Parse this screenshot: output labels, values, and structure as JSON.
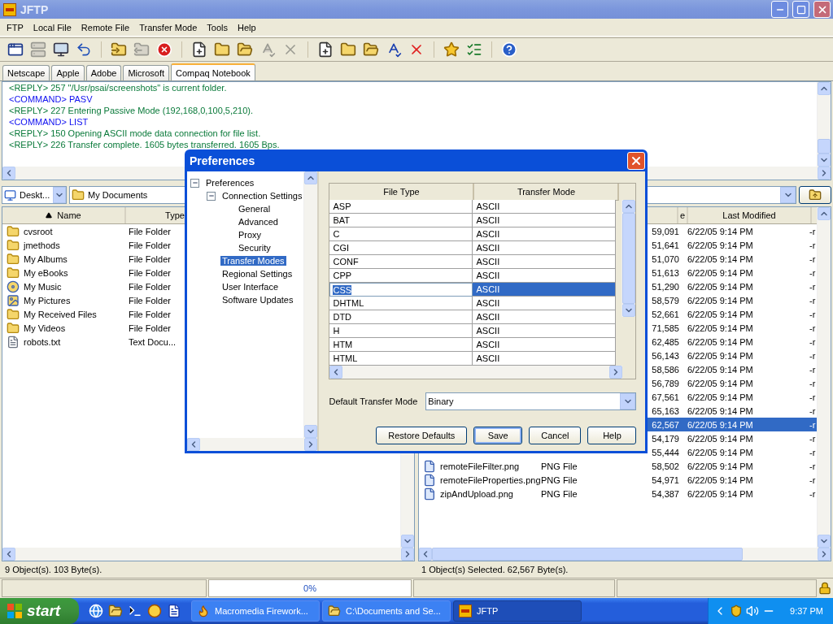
{
  "window": {
    "title": "JFTP"
  },
  "menu": [
    "FTP",
    "Local File",
    "Remote File",
    "Transfer Mode",
    "Tools",
    "Help"
  ],
  "toolbar": [
    {
      "kind": "window",
      "disabled": false
    },
    {
      "kind": "server",
      "disabled": true
    },
    {
      "kind": "monitor",
      "disabled": false
    },
    {
      "kind": "undo",
      "disabled": false
    },
    {
      "kind": "separator"
    },
    {
      "kind": "download",
      "disabled": false
    },
    {
      "kind": "upload",
      "disabled": true
    },
    {
      "kind": "stop",
      "disabled": false
    },
    {
      "kind": "separator"
    },
    {
      "kind": "new-file",
      "disabled": false
    },
    {
      "kind": "new-folder",
      "disabled": false
    },
    {
      "kind": "open-folder",
      "disabled": false
    },
    {
      "kind": "rename",
      "disabled": true
    },
    {
      "kind": "delete",
      "disabled": true
    },
    {
      "kind": "separator"
    },
    {
      "kind": "new-file",
      "disabled": false
    },
    {
      "kind": "new-folder",
      "disabled": false
    },
    {
      "kind": "open-folder",
      "disabled": false
    },
    {
      "kind": "rename",
      "disabled": false
    },
    {
      "kind": "delete",
      "disabled": false
    },
    {
      "kind": "separator"
    },
    {
      "kind": "favorite",
      "disabled": false
    },
    {
      "kind": "list",
      "disabled": false
    },
    {
      "kind": "separator"
    },
    {
      "kind": "help",
      "disabled": false
    }
  ],
  "tabs": [
    {
      "label": "Netscape",
      "selected": false
    },
    {
      "label": "Apple",
      "selected": false
    },
    {
      "label": "Adobe",
      "selected": false
    },
    {
      "label": "Microsoft",
      "selected": false
    },
    {
      "label": "Compaq Notebook",
      "selected": true
    }
  ],
  "log": [
    {
      "kind": "reply",
      "text": "<REPLY> 257 \"/Usr/psai/screenshots\" is current folder."
    },
    {
      "kind": "command",
      "text": "<COMMAND> PASV"
    },
    {
      "kind": "reply",
      "text": "<REPLY> 227 Entering Passive Mode (192,168,0,100,5,210)."
    },
    {
      "kind": "command",
      "text": "<COMMAND> LIST"
    },
    {
      "kind": "reply",
      "text": "<REPLY> 150 Opening ASCII mode data connection for file list."
    },
    {
      "kind": "reply",
      "text": "<REPLY> 226 Transfer complete. 1605 bytes transferred. 1605 Bps."
    }
  ],
  "local_pane": {
    "drive": "Deskt...",
    "path": "My Documents",
    "columns": [
      "Name",
      "Type"
    ],
    "rows": [
      {
        "kind": "folder",
        "name": "cvsroot",
        "type": "File Folder"
      },
      {
        "kind": "folder",
        "name": "jmethods",
        "type": "File Folder"
      },
      {
        "kind": "folder",
        "name": "My Albums",
        "type": "File Folder"
      },
      {
        "kind": "folder",
        "name": "My eBooks",
        "type": "File Folder"
      },
      {
        "kind": "music",
        "name": "My Music",
        "type": "File Folder"
      },
      {
        "kind": "pictures",
        "name": "My Pictures",
        "type": "File Folder"
      },
      {
        "kind": "folder",
        "name": "My Received Files",
        "type": "File Folder"
      },
      {
        "kind": "folder",
        "name": "My Videos",
        "type": "File Folder"
      },
      {
        "kind": "text",
        "name": "robots.txt",
        "type": "Text Docu..."
      }
    ],
    "status": "9 Object(s). 103 Byte(s)."
  },
  "remote_pane": {
    "headers": {
      "size": "e",
      "modified": "Last Modified"
    },
    "rows": [
      {
        "size": "59,091",
        "modified": "6/22/05 9:14 PM",
        "perm": "-r",
        "selected": false
      },
      {
        "size": "51,641",
        "modified": "6/22/05 9:14 PM",
        "perm": "-r",
        "selected": false
      },
      {
        "size": "51,070",
        "modified": "6/22/05 9:14 PM",
        "perm": "-r",
        "selected": false
      },
      {
        "size": "51,613",
        "modified": "6/22/05 9:14 PM",
        "perm": "-r",
        "selected": false
      },
      {
        "size": "51,290",
        "modified": "6/22/05 9:14 PM",
        "perm": "-r",
        "selected": false
      },
      {
        "size": "58,579",
        "modified": "6/22/05 9:14 PM",
        "perm": "-r",
        "selected": false
      },
      {
        "size": "52,661",
        "modified": "6/22/05 9:14 PM",
        "perm": "-r",
        "selected": false
      },
      {
        "size": "71,585",
        "modified": "6/22/05 9:14 PM",
        "perm": "-r",
        "selected": false
      },
      {
        "size": "62,485",
        "modified": "6/22/05 9:14 PM",
        "perm": "-r",
        "selected": false
      },
      {
        "size": "56,143",
        "modified": "6/22/05 9:14 PM",
        "perm": "-r",
        "selected": false
      },
      {
        "size": "58,586",
        "modified": "6/22/05 9:14 PM",
        "perm": "-r",
        "selected": false
      },
      {
        "size": "56,789",
        "modified": "6/22/05 9:14 PM",
        "perm": "-r",
        "selected": false
      },
      {
        "size": "67,561",
        "modified": "6/22/05 9:14 PM",
        "perm": "-r",
        "selected": false
      },
      {
        "size": "65,163",
        "modified": "6/22/05 9:14 PM",
        "perm": "-r",
        "selected": false
      },
      {
        "size": "62,567",
        "modified": "6/22/05 9:14 PM",
        "perm": "-r",
        "selected": true
      },
      {
        "size": "54,179",
        "modified": "6/22/05 9:14 PM",
        "perm": "-r",
        "selected": false
      },
      {
        "size": "55,444",
        "modified": "6/22/05 9:14 PM",
        "perm": "-r",
        "selected": false
      },
      {
        "kind": "image",
        "name": "remoteFileFilter.png",
        "type": "PNG File",
        "size": "58,502",
        "modified": "6/22/05 9:14 PM",
        "perm": "-r",
        "selected": false
      },
      {
        "kind": "image",
        "name": "remoteFileProperties.png",
        "type": "PNG File",
        "size": "54,971",
        "modified": "6/22/05 9:14 PM",
        "perm": "-r",
        "selected": false
      },
      {
        "kind": "image",
        "name": "zipAndUpload.png",
        "type": "PNG File",
        "size": "54,387",
        "modified": "6/22/05 9:14 PM",
        "perm": "-r",
        "selected": false
      }
    ],
    "status": "1 Object(s) Selected. 62,567 Byte(s)."
  },
  "progress": {
    "label": "0%",
    "level": 0
  },
  "dialog": {
    "title": "Preferences",
    "tree": [
      {
        "label": "Preferences",
        "expanded": true,
        "selected": false,
        "children": [
          {
            "label": "Connection Settings",
            "expanded": true,
            "selected": false,
            "children": [
              {
                "label": "General",
                "selected": false
              },
              {
                "label": "Advanced",
                "selected": false
              },
              {
                "label": "Proxy",
                "selected": false
              },
              {
                "label": "Security",
                "selected": false
              }
            ]
          },
          {
            "label": "Transfer Modes",
            "selected": true
          },
          {
            "label": "Regional Settings",
            "selected": false
          },
          {
            "label": "User Interface",
            "selected": false
          },
          {
            "label": "Software Updates",
            "selected": false
          }
        ]
      }
    ],
    "table": {
      "columns": [
        "File Type",
        "Transfer Mode"
      ],
      "rows": [
        {
          "file_type": "ASP",
          "mode": "ASCII",
          "selected": false
        },
        {
          "file_type": "BAT",
          "mode": "ASCII",
          "selected": false
        },
        {
          "file_type": "C",
          "mode": "ASCII",
          "selected": false
        },
        {
          "file_type": "CGI",
          "mode": "ASCII",
          "selected": false
        },
        {
          "file_type": "CONF",
          "mode": "ASCII",
          "selected": false
        },
        {
          "file_type": "CPP",
          "mode": "ASCII",
          "selected": false
        },
        {
          "file_type": "CSS",
          "mode": "ASCII",
          "selected": true
        },
        {
          "file_type": "DHTML",
          "mode": "ASCII",
          "selected": false
        },
        {
          "file_type": "DTD",
          "mode": "ASCII",
          "selected": false
        },
        {
          "file_type": "H",
          "mode": "ASCII",
          "selected": false
        },
        {
          "file_type": "HTM",
          "mode": "ASCII",
          "selected": false
        },
        {
          "file_type": "HTML",
          "mode": "ASCII",
          "selected": false
        }
      ]
    },
    "default_mode": {
      "label": "Default Transfer Mode",
      "value": "Binary"
    },
    "buttons": [
      {
        "label": "Restore Defaults",
        "default": false
      },
      {
        "label": "Save",
        "default": true
      },
      {
        "label": "Cancel",
        "default": false
      },
      {
        "label": "Help",
        "default": false
      }
    ]
  },
  "taskbar": {
    "start": "start",
    "tasks": [
      {
        "kind": "fireworks",
        "label": "Macromedia Firework...",
        "selected": false
      },
      {
        "kind": "folder",
        "label": "C:\\Documents and Se...",
        "selected": false
      },
      {
        "kind": "ftp",
        "label": "JFTP",
        "selected": true
      }
    ],
    "clock": "9:37 PM"
  }
}
